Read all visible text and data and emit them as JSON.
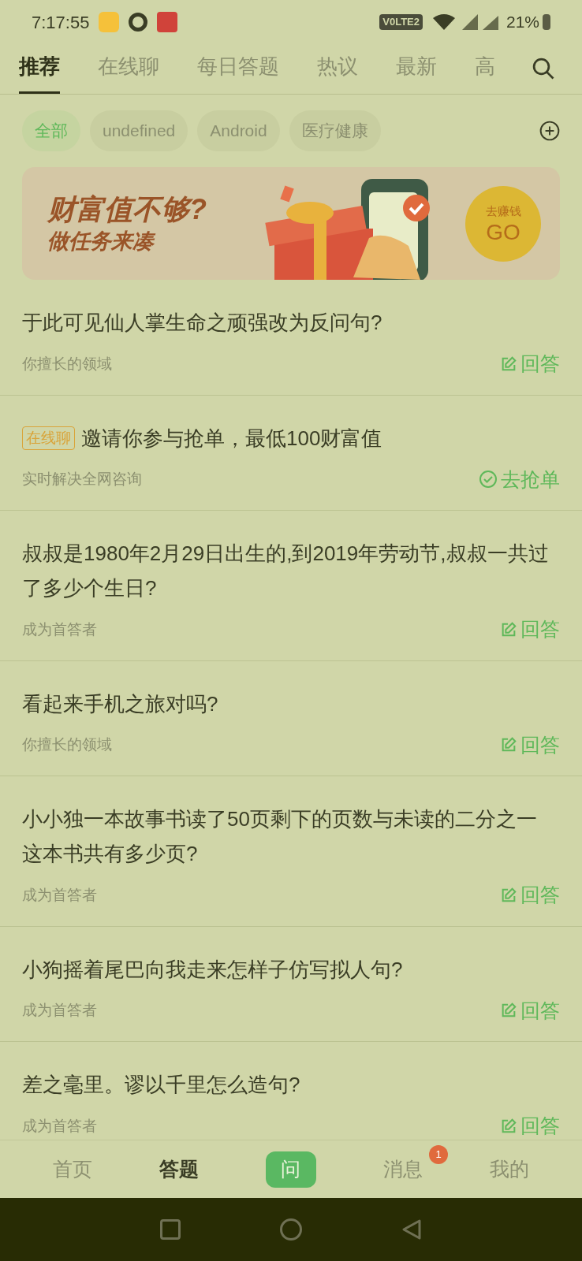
{
  "status_bar": {
    "time": "7:17:55",
    "volte": "V0LTE2",
    "battery": "21%"
  },
  "tabs": [
    {
      "label": "推荐",
      "selected": true
    },
    {
      "label": "在线聊",
      "selected": false
    },
    {
      "label": "每日答题",
      "selected": false
    },
    {
      "label": "热议",
      "selected": false
    },
    {
      "label": "最新",
      "selected": false
    },
    {
      "label": "高",
      "selected": false
    }
  ],
  "chips": [
    {
      "label": "全部",
      "selected": true
    },
    {
      "label": "undefined",
      "selected": false
    },
    {
      "label": "Android",
      "selected": false
    },
    {
      "label": "医疗健康",
      "selected": false
    }
  ],
  "banner": {
    "title": "财富值不够?",
    "subtitle": "做任务来凑",
    "coin_top": "去赚钱",
    "coin_bottom": "GO"
  },
  "questions": [
    {
      "kind": "answer",
      "title": "于此可见仙人掌生命之顽强改为反问句?",
      "note": "你擅长的领域",
      "action": "回答"
    },
    {
      "kind": "grab",
      "tag": "在线聊",
      "title": "邀请你参与抢单，最低100财富值",
      "note": "实时解决全网咨询",
      "action": "去抢单"
    },
    {
      "kind": "answer",
      "title": "叔叔是1980年2月29日出生的,到2019年劳动节,叔叔一共过了多少个生日?",
      "note": "成为首答者",
      "action": "回答"
    },
    {
      "kind": "answer",
      "title": "看起来手机之旅对吗?",
      "note": "你擅长的领域",
      "action": "回答"
    },
    {
      "kind": "answer",
      "title": "小小独一本故事书读了50页剩下的页数与未读的二分之一这本书共有多少页?",
      "note": "成为首答者",
      "action": "回答"
    },
    {
      "kind": "answer",
      "title": "小狗摇着尾巴向我走来怎样子仿写拟人句?",
      "note": "成为首答者",
      "action": "回答"
    },
    {
      "kind": "answer",
      "title": "差之毫里。谬以千里怎么造句?",
      "note": "成为首答者",
      "action": "回答"
    }
  ],
  "bottom_nav": [
    {
      "label": "首页",
      "selected": false,
      "kind": "tab"
    },
    {
      "label": "答题",
      "selected": true,
      "kind": "tab"
    },
    {
      "label": "问",
      "kind": "ask"
    },
    {
      "label": "消息",
      "selected": false,
      "kind": "tab",
      "badge": "1"
    },
    {
      "label": "我的",
      "selected": false,
      "kind": "tab"
    }
  ]
}
